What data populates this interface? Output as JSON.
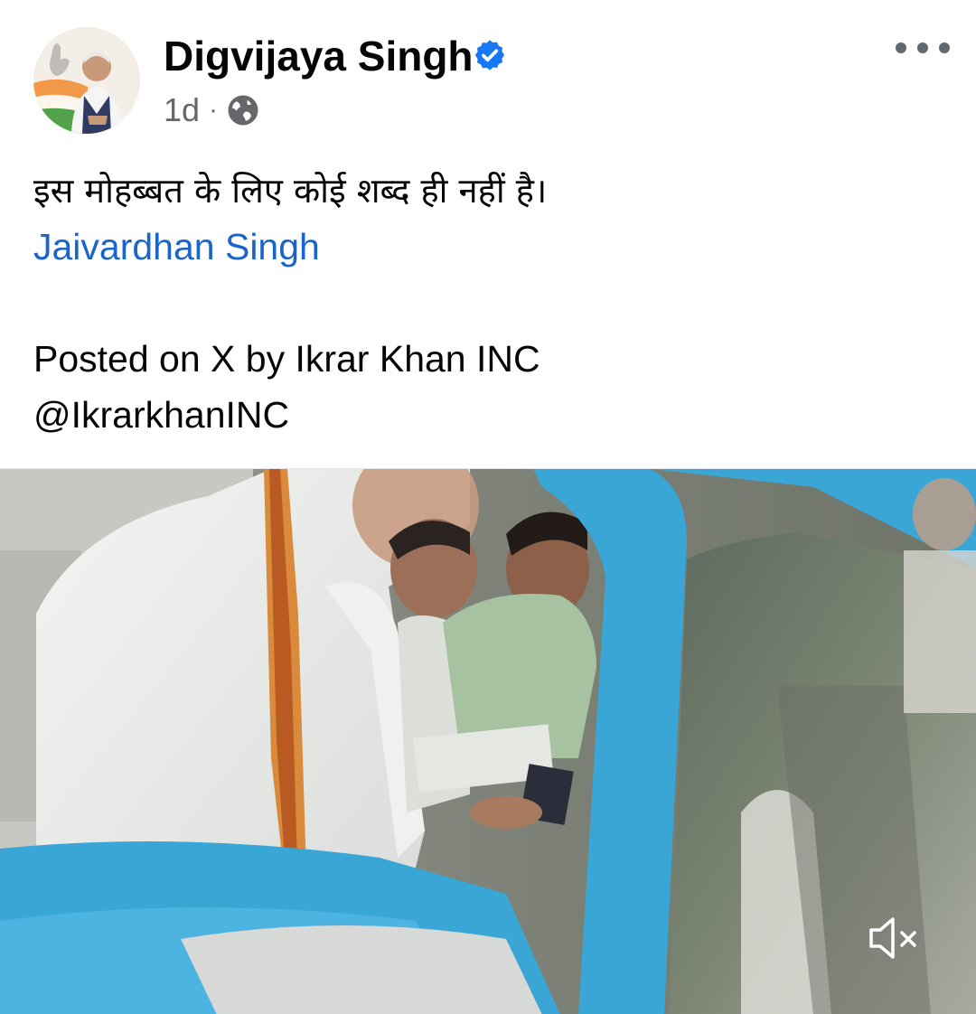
{
  "post": {
    "author": "Digvijaya Singh",
    "verified": true,
    "time": "1d",
    "separator": "·",
    "audience_icon": "globe-icon",
    "more_icon": "more-options-icon",
    "text_line1": "इस मोहब्बत के लिए कोई शब्द ही नहीं है।",
    "mention": "Jaivardhan Singh",
    "source_line1": "Posted on X by Ikrar Khan INC",
    "source_line2": "@IkrarkhanINC"
  },
  "media": {
    "type": "video",
    "sound_icon": "muted-speaker-icon",
    "muted": true
  },
  "colors": {
    "link": "#1b65c9",
    "verified_badge": "#1877f2",
    "meta_gray": "#65676b",
    "vehicle_blue": "#3aa6d6"
  }
}
